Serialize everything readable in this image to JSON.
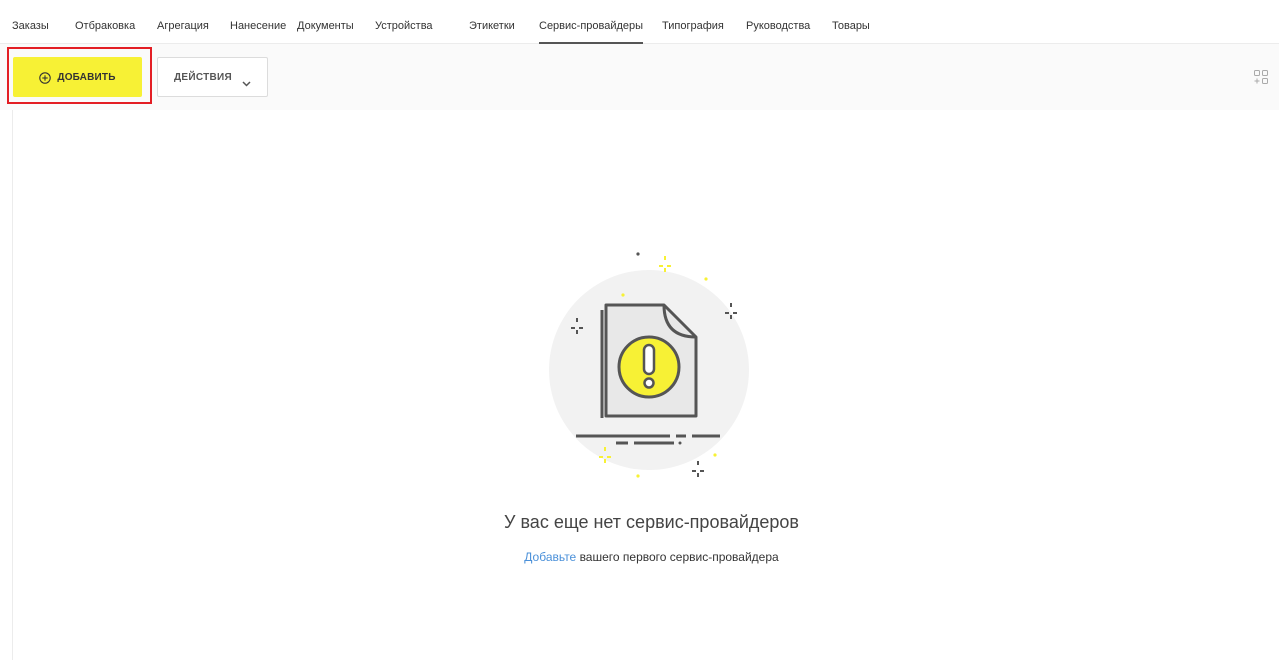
{
  "tabs": [
    {
      "label": "Заказы"
    },
    {
      "label": "Отбраковка"
    },
    {
      "label": "Агрегация"
    },
    {
      "label": "Нанесение"
    },
    {
      "label": "Документы"
    },
    {
      "label": "Устройства"
    },
    {
      "label": "Этикетки"
    },
    {
      "label": "Сервис-провайдеры",
      "active": true
    },
    {
      "label": "Типография"
    },
    {
      "label": "Руководства"
    },
    {
      "label": "Товары"
    }
  ],
  "toolbar": {
    "add_label": "ДОБАВИТЬ",
    "actions_label": "ДЕЙСТВИЯ",
    "add_icon": "plus-circle-icon",
    "actions_icon": "chevron-down-icon",
    "settings_icon": "grid-settings-icon"
  },
  "empty_state": {
    "title": "У вас еще нет сервис-провайдеров",
    "link_text": "Добавьте",
    "subtitle_rest": " вашего первого сервис-провайдера",
    "illustration": "document-warning-icon"
  },
  "colors": {
    "accent_yellow": "#f7f135",
    "highlight_red": "#e31e24",
    "link_blue": "#4a90d9"
  }
}
